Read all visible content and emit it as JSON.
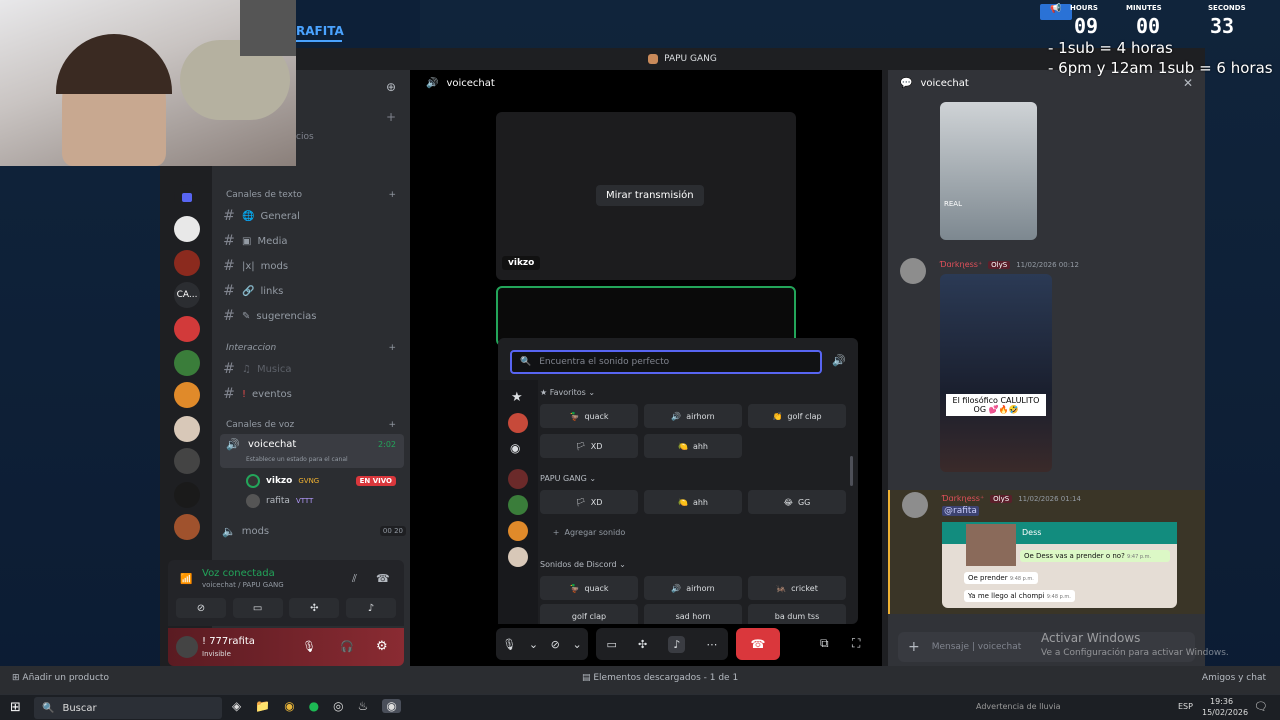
{
  "stream_overlay": {
    "streamer_name": "RAFITA",
    "timer": {
      "hours_label": "HOURS",
      "minutes_label": "MINUTES",
      "seconds_label": "SECONDS",
      "hours": "09",
      "minutes": "00",
      "seconds": "33"
    },
    "rules": [
      "- 1sub = 4 horas",
      "- 6pm y 12am 1sub = 6 horas"
    ]
  },
  "window": {
    "title": "PAPU GANG"
  },
  "channels": {
    "partial_label": "cios",
    "text_category": "Canales de texto",
    "text_channels": [
      {
        "name": "General",
        "icon": "globe-icon"
      },
      {
        "name": "Media",
        "icon": "image-icon"
      },
      {
        "name": "mods",
        "icon": "x-icon"
      },
      {
        "name": "links",
        "icon": "link-icon"
      },
      {
        "name": "sugerencias",
        "icon": "pencil-icon"
      }
    ],
    "interaction_category": "Interaccion",
    "interaction_channels": [
      {
        "name": "Musica",
        "icon": "music-icon"
      },
      {
        "name": "eventos",
        "icon": "exclaim-icon"
      }
    ],
    "voice_category": "Canales de voz",
    "voice_channel": {
      "name": "voicechat",
      "time": "2:02",
      "status_placeholder": "Establece un estado para el canal"
    },
    "voice_members": [
      {
        "name": "vikzo",
        "badge": "GVNG",
        "live_badge": "EN VIVO"
      },
      {
        "name": "rafita",
        "badge": "VTTT"
      }
    ],
    "voice_channel_2": {
      "name": "mods",
      "count_left": "00",
      "count_right": "20"
    },
    "connection": {
      "status": "Voz conectada",
      "location": "voicechat / PAPU GANG"
    },
    "user": {
      "name": "! 777rafita",
      "status": "Invisible"
    }
  },
  "stage": {
    "header": "voicechat",
    "watch_button": "Mirar transmisión",
    "streamer_tag": "vikzo",
    "soundboard": {
      "search_placeholder": "Encuentra el sonido perfecto",
      "favorites_label": "Favoritos",
      "favorites": [
        "quack",
        "airhorn",
        "golf clap",
        "XD",
        "ahh"
      ],
      "server_label": "PAPU GANG",
      "server_sounds": [
        "XD",
        "ahh",
        "GG"
      ],
      "add_sound": "Agregar sonido",
      "discord_label": "Sonidos de Discord",
      "discord_sounds": [
        "quack",
        "airhorn",
        "cricket",
        "golf clap",
        "sad horn",
        "ba dum tss"
      ]
    }
  },
  "chat": {
    "header": "voicechat",
    "video_caption": "REAL",
    "messages": [
      {
        "author": "Ɗɑrkɳess⁺",
        "badge": "OlyS",
        "time": "11/02/2026 00:12",
        "caption": "El filosófico CALULITO OG 💕🔥🤣"
      },
      {
        "author": "Ɗɑrkɳess⁺",
        "badge": "OlyS",
        "time": "11/02/2026 01:14",
        "mention": "@rafita",
        "whatsapp": {
          "contact": "Dess",
          "bubble1": "Oe Dess vas a prender o no?",
          "bubble1_time": "9:47 p.m.",
          "bubble2": "Oe prender",
          "bubble2_time": "9:48 p.m.",
          "bubble3": "Ya me llego al chompi",
          "bubble3_time": "9:48 p.m."
        }
      }
    ],
    "input_placeholder": "Mensaje | voicechat"
  },
  "activation": {
    "title": "Activar Windows",
    "subtitle": "Ve a Configuración para activar Windows."
  },
  "strip": {
    "add_product": "Añadir un producto",
    "downloads": "Elementos descargados - 1 de 1",
    "friends": "Amigos y chat"
  },
  "taskbar": {
    "search": "Buscar",
    "weather": "Advertencia de lluvia",
    "lang": "ESP",
    "time": "19:36",
    "date": "15/02/2026"
  }
}
